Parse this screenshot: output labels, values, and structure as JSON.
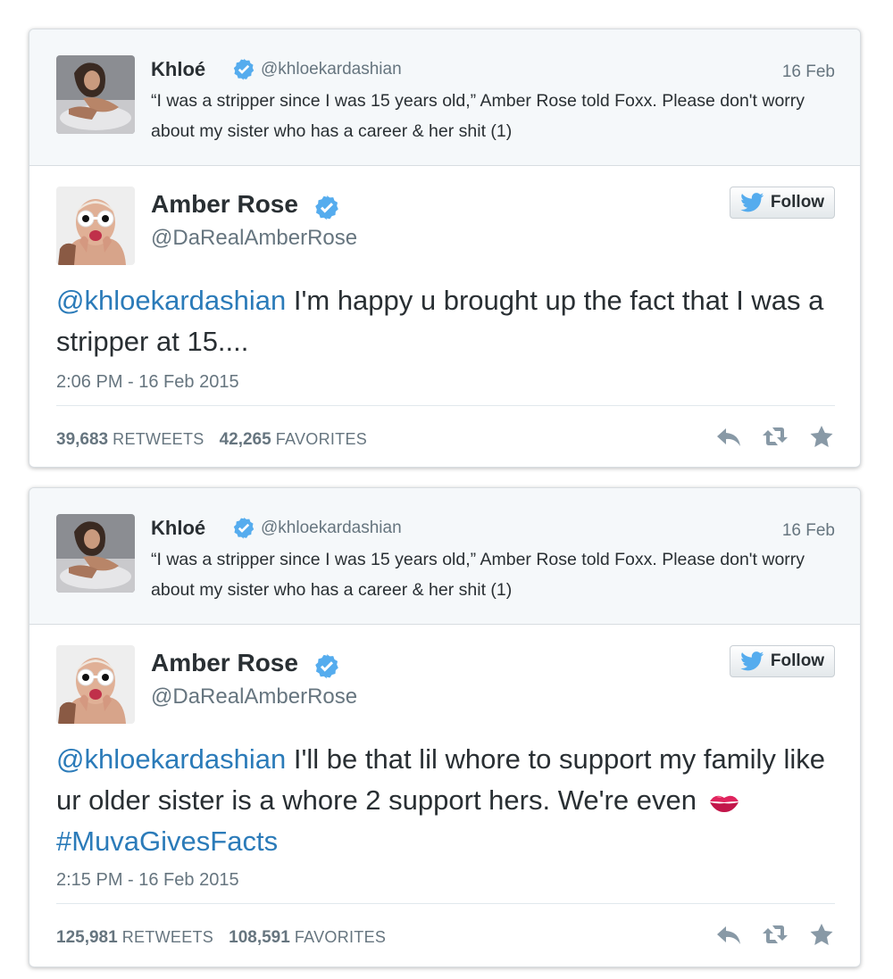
{
  "tweets": [
    {
      "quoted": {
        "name": "Khloé",
        "handle": "@khloekardashian",
        "date": "16 Feb",
        "text": "“I was a stripper since I was 15 years old,” Amber Rose told Foxx. Please don't worry about my sister who has a career & her shit (1)"
      },
      "author": {
        "name": "Amber Rose",
        "handle": "@DaRealAmberRose"
      },
      "follow_label": "Follow",
      "text": {
        "mention": "@khloekardashian",
        "body": " I'm happy u brought up the fact that I was a stripper at 15....",
        "pre_hashtag": "",
        "hashtag": ""
      },
      "timestamp": "2:06 PM - 16 Feb 2015",
      "retweets": "39,683",
      "retweets_label": "RETWEETS",
      "favorites": "42,265",
      "favorites_label": "FAVORITES"
    },
    {
      "quoted": {
        "name": "Khloé",
        "handle": "@khloekardashian",
        "date": "16 Feb",
        "text": "“I was a stripper since I was 15 years old,” Amber Rose told Foxx. Please don't worry about my sister who has a career & her shit (1)"
      },
      "author": {
        "name": "Amber Rose",
        "handle": "@DaRealAmberRose"
      },
      "follow_label": "Follow",
      "text": {
        "mention": "@khloekardashian",
        "body": " I'll be that lil whore to support my family like ur older sister is a whore 2 support hers. We're even",
        "hashtag": "#MuvaGivesFacts"
      },
      "timestamp": "2:15 PM - 16 Feb 2015",
      "retweets": "125,981",
      "retweets_label": "RETWEETS",
      "favorites": "108,591",
      "favorites_label": "FAVORITES"
    }
  ],
  "colors": {
    "link": "#2b7bb9",
    "verified": "#55acee",
    "muted": "#66757f",
    "text": "#292f33"
  },
  "icons": [
    "verified-badge-icon",
    "twitter-bird-icon",
    "reply-icon",
    "retweet-icon",
    "favorite-star-icon",
    "kiss-emoji-icon"
  ]
}
